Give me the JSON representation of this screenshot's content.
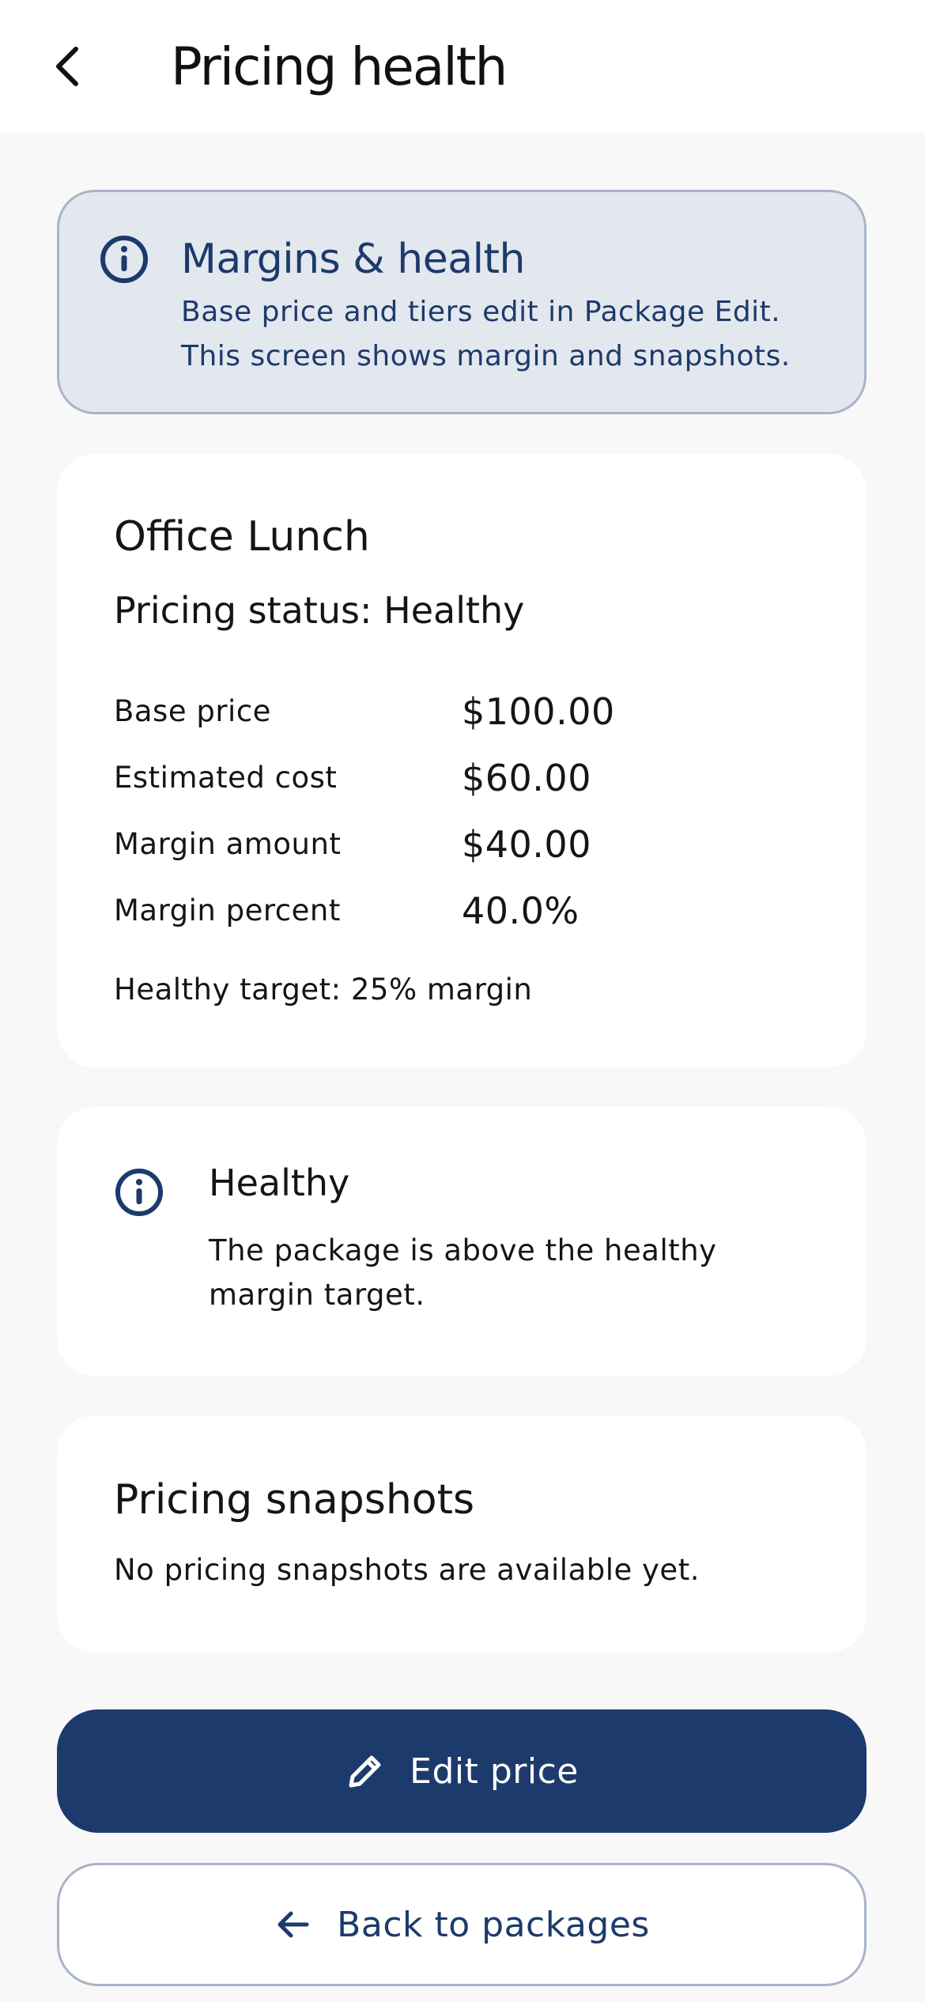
{
  "header": {
    "title": "Pricing health",
    "back_icon": "chevron-left-icon"
  },
  "info_banner": {
    "icon": "info-icon",
    "title": "Margins & health",
    "body": "Base price and tiers edit in Package Edit. This screen shows margin and snapshots."
  },
  "summary": {
    "package_name": "Office Lunch",
    "pricing_status": "Pricing status: Healthy",
    "metrics": [
      {
        "label": "Base price",
        "value": "$100.00"
      },
      {
        "label": "Estimated cost",
        "value": "$60.00"
      },
      {
        "label": "Margin amount",
        "value": "$40.00"
      },
      {
        "label": "Margin percent",
        "value": "40.0%"
      }
    ],
    "target_note": "Healthy target: 25% margin"
  },
  "health": {
    "icon": "info-icon",
    "title": "Healthy",
    "body": "The package is above the healthy margin target."
  },
  "snapshots": {
    "title": "Pricing snapshots",
    "empty_text": "No pricing snapshots are available yet."
  },
  "actions": {
    "edit_label": "Edit price",
    "edit_icon": "pencil-icon",
    "back_label": "Back to packages",
    "back_icon": "arrow-left-icon"
  },
  "colors": {
    "primary": "#1c3a6c",
    "banner_bg": "#e3e7ee",
    "banner_border": "#a8b4c8",
    "page_bg": "#f8f8f8"
  }
}
